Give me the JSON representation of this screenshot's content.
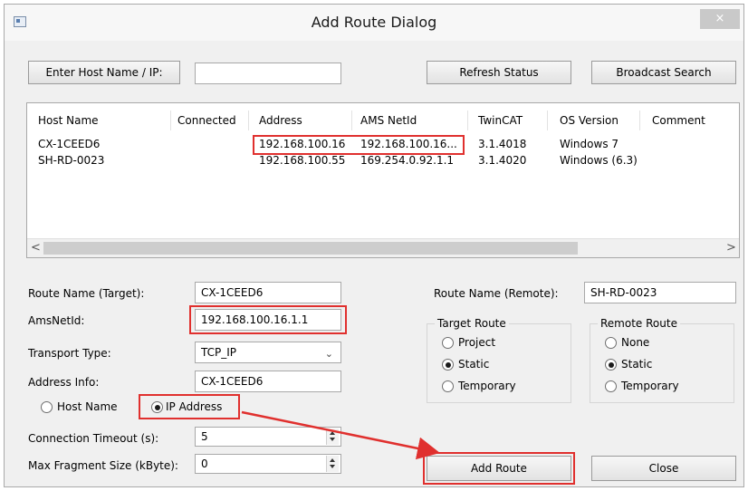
{
  "window": {
    "title": "Add Route Dialog",
    "close": "×"
  },
  "top_bar": {
    "host_button": "Enter Host Name / IP:",
    "host_input_value": "",
    "refresh_button": "Refresh Status",
    "broadcast_button": "Broadcast Search"
  },
  "host_table": {
    "columns": [
      "Host Name",
      "Connected",
      "Address",
      "AMS NetId",
      "TwinCAT",
      "OS Version",
      "Comment"
    ],
    "rows": [
      [
        "CX-1CEED6",
        "",
        "192.168.100.16",
        "192.168.100.16...",
        "3.1.4018",
        "Windows 7",
        ""
      ],
      [
        "SH-RD-0023",
        "",
        "192.168.100.55",
        "169.254.0.92.1.1",
        "3.1.4020",
        "Windows (6.3)",
        ""
      ]
    ],
    "scroll_left": "<",
    "scroll_right": ">"
  },
  "form": {
    "route_name_target_label": "Route Name (Target):",
    "route_name_target_value": "CX-1CEED6",
    "amsnetid_label": "AmsNetId:",
    "amsnetid_value": "192.168.100.16.1.1",
    "transport_label": "Transport Type:",
    "transport_value": "TCP_IP",
    "address_info_label": "Address Info:",
    "address_info_value": "CX-1CEED6",
    "host_name_radio": "Host Name",
    "ip_address_radio": "IP Address",
    "timeout_label": "Connection Timeout (s):",
    "timeout_value": "5",
    "max_fragment_label": "Max Fragment Size (kByte):",
    "max_fragment_value": "0",
    "route_name_remote_label": "Route Name (Remote):",
    "route_name_remote_value": "SH-RD-0023"
  },
  "target_route": {
    "title": "Target Route",
    "options": [
      "Project",
      "Static",
      "Temporary"
    ],
    "selected": "Static"
  },
  "remote_route": {
    "title": "Remote Route",
    "options": [
      "None",
      "Static",
      "Temporary"
    ],
    "selected": "Static"
  },
  "buttons": {
    "add_route": "Add Route",
    "close": "Close"
  },
  "colors": {
    "highlight": "#e0302e"
  }
}
